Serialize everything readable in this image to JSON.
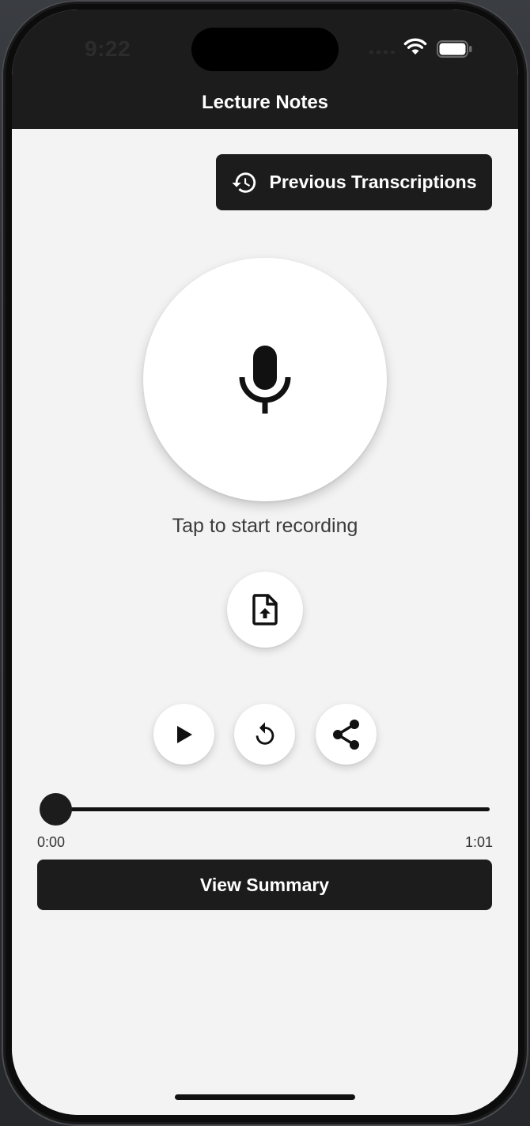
{
  "status_bar": {
    "time": "9:22",
    "icons": [
      "cellular-signal-icon",
      "wifi-icon",
      "battery-icon"
    ]
  },
  "nav": {
    "title": "Lecture Notes"
  },
  "toolbar": {
    "previous_label": "Previous Transcriptions",
    "previous_icon": "history-icon"
  },
  "recorder": {
    "mic_icon": "microphone-icon",
    "hint": "Tap to start recording"
  },
  "actions": {
    "upload_icon": "file-upload-icon",
    "play_icon": "play-icon",
    "reset_icon": "rotate-left-icon",
    "share_icon": "share-icon"
  },
  "playback": {
    "current_time": "0:00",
    "duration": "1:01",
    "progress": 0
  },
  "summary": {
    "label": "View Summary"
  },
  "colors": {
    "dark": "#1c1c1c",
    "background": "#f3f3f3",
    "surface": "#ffffff",
    "text": "#3b3b3b"
  }
}
